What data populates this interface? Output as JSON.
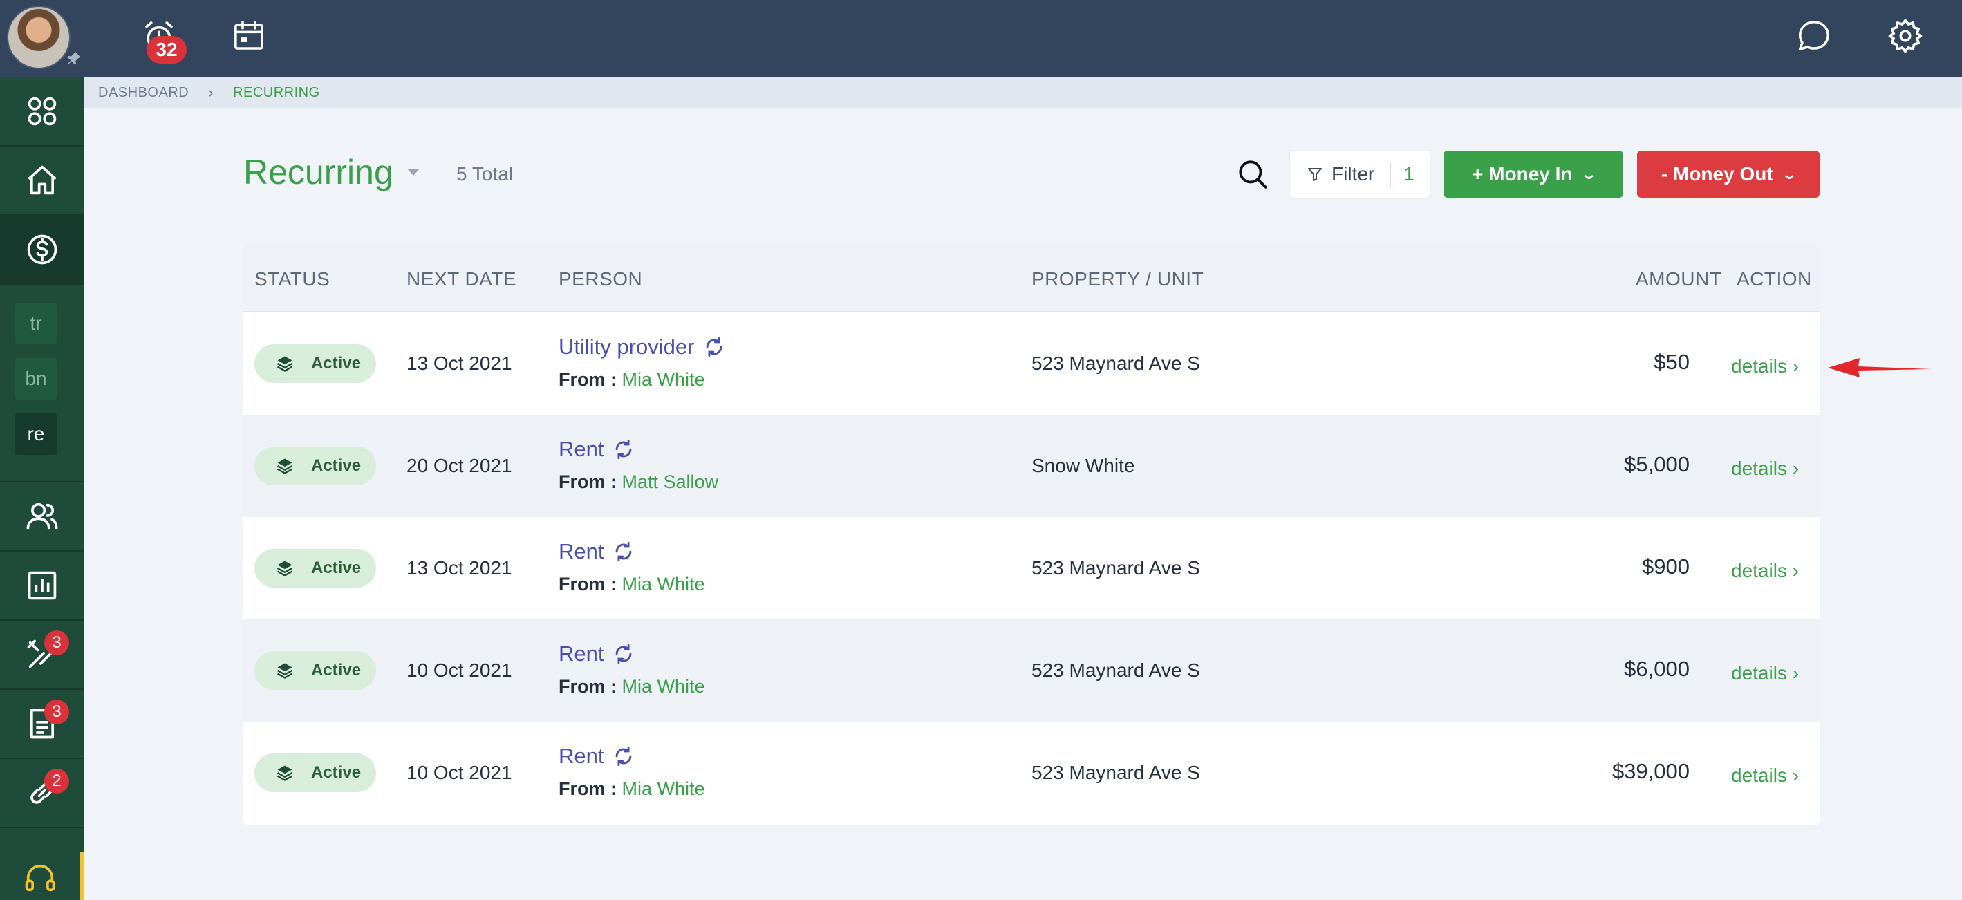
{
  "topbar": {
    "alarm_badge": "32",
    "icons": [
      "avatar",
      "pin-icon",
      "alarm-clock-icon",
      "calendar-icon",
      "chat-icon",
      "gear-icon"
    ]
  },
  "sidebar": {
    "items": [
      {
        "icon": "apps-grid-icon"
      },
      {
        "icon": "home-icon"
      },
      {
        "icon": "dollar-icon",
        "active": true
      },
      {
        "icon": "users-icon"
      },
      {
        "icon": "chart-icon"
      },
      {
        "icon": "tools-icon",
        "badge": "3"
      },
      {
        "icon": "document-icon",
        "badge": "3"
      },
      {
        "icon": "link-icon",
        "badge": "2"
      },
      {
        "icon": "headset-icon"
      }
    ],
    "chips": [
      "tr",
      "bn",
      "re"
    ]
  },
  "breadcrumb": {
    "items": [
      "DASHBOARD",
      "RECURRING"
    ],
    "separator": "›"
  },
  "header": {
    "title": "Recurring",
    "total": "5 Total",
    "filter_label": "Filter",
    "filter_count": "1",
    "money_in_label": "+ Money In",
    "money_out_label": "- Money Out"
  },
  "table": {
    "columns": {
      "status": "STATUS",
      "next_date": "NEXT DATE",
      "person": "PERSON",
      "property": "PROPERTY / UNIT",
      "amount": "AMOUNT",
      "action": "ACTION"
    },
    "rows": [
      {
        "status": "Active",
        "next_date": "13 Oct 2021",
        "title": "Utility provider",
        "from_label": "From :",
        "from_name": "Mia White",
        "property": "523 Maynard Ave S",
        "amount": "$50",
        "action": "details ›"
      },
      {
        "status": "Active",
        "next_date": "20 Oct 2021",
        "title": "Rent",
        "from_label": "From :",
        "from_name": "Matt Sallow",
        "property": "Snow White",
        "amount": "$5,000",
        "action": "details ›"
      },
      {
        "status": "Active",
        "next_date": "13 Oct 2021",
        "title": "Rent",
        "from_label": "From :",
        "from_name": "Mia White",
        "property": "523 Maynard Ave S",
        "amount": "$900",
        "action": "details ›"
      },
      {
        "status": "Active",
        "next_date": "10 Oct 2021",
        "title": "Rent",
        "from_label": "From :",
        "from_name": "Mia White",
        "property": "523 Maynard Ave S",
        "amount": "$6,000",
        "action": "details ›"
      },
      {
        "status": "Active",
        "next_date": "10 Oct 2021",
        "title": "Rent",
        "from_label": "From :",
        "from_name": "Mia White",
        "property": "523 Maynard Ave S",
        "amount": "$39,000",
        "action": "details ›"
      }
    ]
  },
  "colors": {
    "accent_green": "#3aa04a",
    "danger_red": "#dc3b3f",
    "topbar": "#33455c",
    "sidebar": "#1e4b3a",
    "link_purple": "#4a4fae",
    "annotation_arrow": "#e3262b"
  }
}
